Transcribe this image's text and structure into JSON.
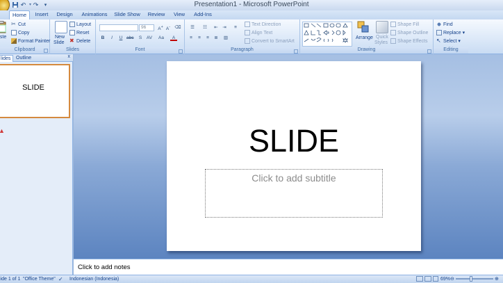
{
  "window": {
    "title": "Presentation1 - Microsoft PowerPoint"
  },
  "quick_access": {
    "save_icon": "save-icon",
    "undo_icon": "undo-icon",
    "redo_icon": "redo-icon"
  },
  "tabs": [
    "Home",
    "Insert",
    "Design",
    "Animations",
    "Slide Show",
    "Review",
    "View",
    "Add-Ins"
  ],
  "active_tab": "Home",
  "ribbon": {
    "clipboard": {
      "label": "Clipboard",
      "paste": "aste",
      "cut": "Cut",
      "copy": "Copy",
      "format_painter": "Format Painter"
    },
    "slides": {
      "label": "Slides",
      "new_slide_1": "New",
      "new_slide_2": "Slide",
      "layout": "Layout",
      "reset": "Reset",
      "delete": "Delete"
    },
    "font": {
      "label": "Font",
      "font_name": "",
      "font_size": "96"
    },
    "paragraph": {
      "label": "Paragraph",
      "text_direction": "Text Direction",
      "align_text": "Align Text",
      "convert_smartart": "Convert to SmartArt"
    },
    "drawing": {
      "label": "Drawing",
      "arrange": "Arrange",
      "quick_styles_1": "Quick",
      "quick_styles_2": "Styles",
      "shape_fill": "Shape Fill",
      "shape_outline": "Shape Outline",
      "shape_effects": "Shape Effects"
    },
    "editing": {
      "label": "Editing",
      "find": "Find",
      "replace": "Replace",
      "select": "Select"
    }
  },
  "left_pane": {
    "tab_slides": "lides",
    "tab_outline": "Outline",
    "close": "x",
    "thumbnail_title": "SLIDE"
  },
  "slide": {
    "title": "SLIDE",
    "subtitle_placeholder": "Click to add subtitle"
  },
  "notes": {
    "placeholder": "Click to add notes"
  },
  "status": {
    "slide_counter": "lide 1 of 1",
    "theme": "\"Office Theme\"",
    "language": "Indonesian (Indonesia)",
    "zoom": "69%"
  },
  "colors": {
    "ribbon_bg": "#dbe8f8",
    "stage_top": "#a5bfe3",
    "stage_bottom": "#5c84c0",
    "thumbnail_border": "#d58a3f"
  }
}
